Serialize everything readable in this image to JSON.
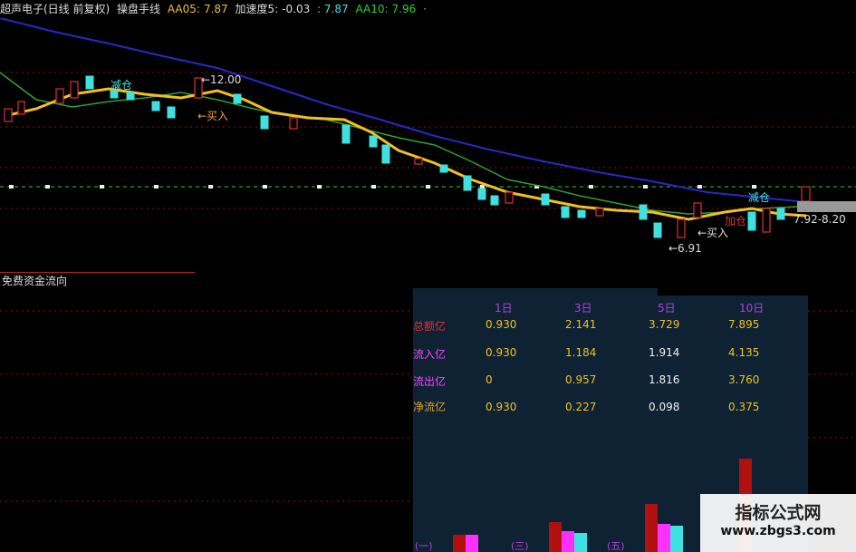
{
  "header": {
    "stock": "超声电子(日线 前复权)",
    "formula": "操盘手线",
    "aa05_label": "AA05:",
    "aa05_value": "7.87",
    "accel_label": "加速度5:",
    "accel_value": "-0.03",
    "sep_value": ": 7.87",
    "aa10_label": "AA10:",
    "aa10_value": "7.96",
    "tail": "·"
  },
  "chart_labels": {
    "high_label": "←12.00",
    "low_label": "←6.91",
    "reduce1": "减仓",
    "buy1": "←买入",
    "reduce2": "减仓",
    "buy2": "←买入",
    "add": "加仓",
    "price_tag": "7.92-8.20"
  },
  "sub_title": "免费资金流向",
  "panel": {
    "columns": [
      "1日",
      "3日",
      "5日",
      "10日"
    ],
    "rows": [
      {
        "label": "总额亿",
        "values": [
          "0.930",
          "2.141",
          "3.729",
          "7.895"
        ]
      },
      {
        "label": "流入亿",
        "values": [
          "0.930",
          "1.184",
          "1.914",
          "4.135"
        ]
      },
      {
        "label": "流出亿",
        "values": [
          "0",
          "0.957",
          "1.816",
          "3.760"
        ]
      },
      {
        "label": "净流亿",
        "values": [
          "0.930",
          "0.227",
          "0.098",
          "0.375"
        ]
      }
    ],
    "bar_labels": [
      "(一)",
      "(三)",
      "(五)"
    ]
  },
  "colors": {
    "up": "#e03030",
    "down": "#40e0e0",
    "yellow_line": "#f0c020",
    "green_line": "#30a030",
    "blue_line": "#2020c0",
    "total": "#b01010",
    "inflow": "#ff30ff",
    "outflow": "#40e0e0",
    "net": "#e0a020"
  },
  "watermark": {
    "title": "指标公式网",
    "url": "www.zbgs3.com"
  }
}
